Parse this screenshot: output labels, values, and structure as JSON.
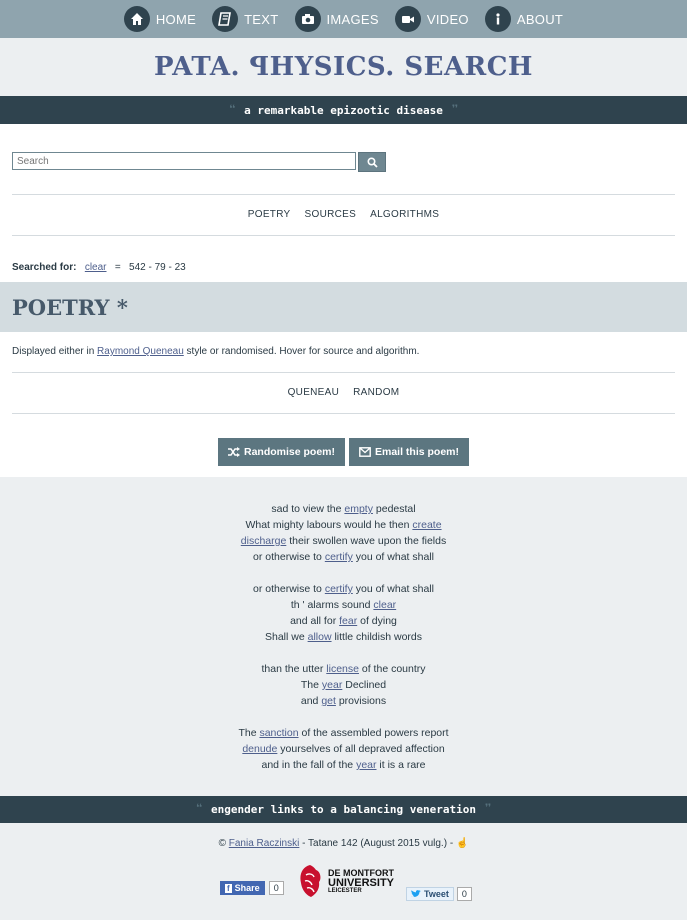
{
  "nav": {
    "items": [
      {
        "label": "HOME",
        "icon": "home-icon"
      },
      {
        "label": "TEXT",
        "icon": "book-icon"
      },
      {
        "label": "IMAGES",
        "icon": "camera-icon"
      },
      {
        "label": "VIDEO",
        "icon": "video-camera-icon"
      },
      {
        "label": "ABOUT",
        "icon": "info-icon"
      }
    ]
  },
  "site": {
    "title": "PATA. ꟼHYSICS. SEARCH",
    "tagline": "a remarkable epizootic disease"
  },
  "search": {
    "placeholder": "Search"
  },
  "tabs": [
    "POETRY",
    "SOURCES",
    "ALGORITHMS"
  ],
  "searched": {
    "label": "Searched for:",
    "query": "clear",
    "equals": "=",
    "counts": "542 - 79 - 23"
  },
  "poetry": {
    "heading": "POETRY *",
    "desc_before": "Displayed either in ",
    "desc_link": "Raymond Queneau",
    "desc_after": " style or randomised. Hover for source and algorithm.",
    "subtabs": [
      "QUENEAU",
      "RANDOM"
    ],
    "randomise_label": "Randomise poem!",
    "email_label": "Email this poem!"
  },
  "poem": [
    [
      {
        "pre": "sad to view the ",
        "link": "empty",
        "post": " pedestal"
      },
      {
        "pre": "What mighty labours would he then ",
        "link": "create",
        "post": ""
      },
      {
        "pre": "",
        "link": "discharge",
        "post": " their swollen wave upon the fields"
      },
      {
        "pre": "or otherwise to ",
        "link": "certify",
        "post": " you of what shall"
      }
    ],
    [
      {
        "pre": "or otherwise to ",
        "link": "certify",
        "post": " you of what shall"
      },
      {
        "pre": "th ' alarms sound ",
        "link": "clear",
        "post": ""
      },
      {
        "pre": "and all for ",
        "link": "fear",
        "post": " of dying"
      },
      {
        "pre": "Shall we ",
        "link": "allow",
        "post": " little childish words"
      }
    ],
    [
      {
        "pre": "than the utter ",
        "link": "license",
        "post": " of the country"
      },
      {
        "pre": "The ",
        "link": "year",
        "post": " Declined"
      },
      {
        "pre": "and ",
        "link": "get",
        "post": " provisions"
      }
    ],
    [
      {
        "pre": "The ",
        "link": "sanction",
        "post": " of the assembled powers report"
      },
      {
        "pre": "",
        "link": "denude",
        "post": " yourselves of all depraved affection"
      },
      {
        "pre": "and in the fall of the ",
        "link": "year",
        "post": " it is a rare"
      }
    ]
  ],
  "footer": {
    "quote": "engender links to a balancing veneration",
    "copy_prefix": "© ",
    "author": "Fania Raczinski",
    "copy_suffix": " - Tatane 142 (August 2015 vulg.) -",
    "share_label": "Share",
    "share_count": "0",
    "logo_line1": "DE MONTFORT",
    "logo_line2": "UNIVERSITY",
    "logo_line3": "LEICESTER",
    "tweet_label": "Tweet",
    "tweet_count": "0"
  }
}
